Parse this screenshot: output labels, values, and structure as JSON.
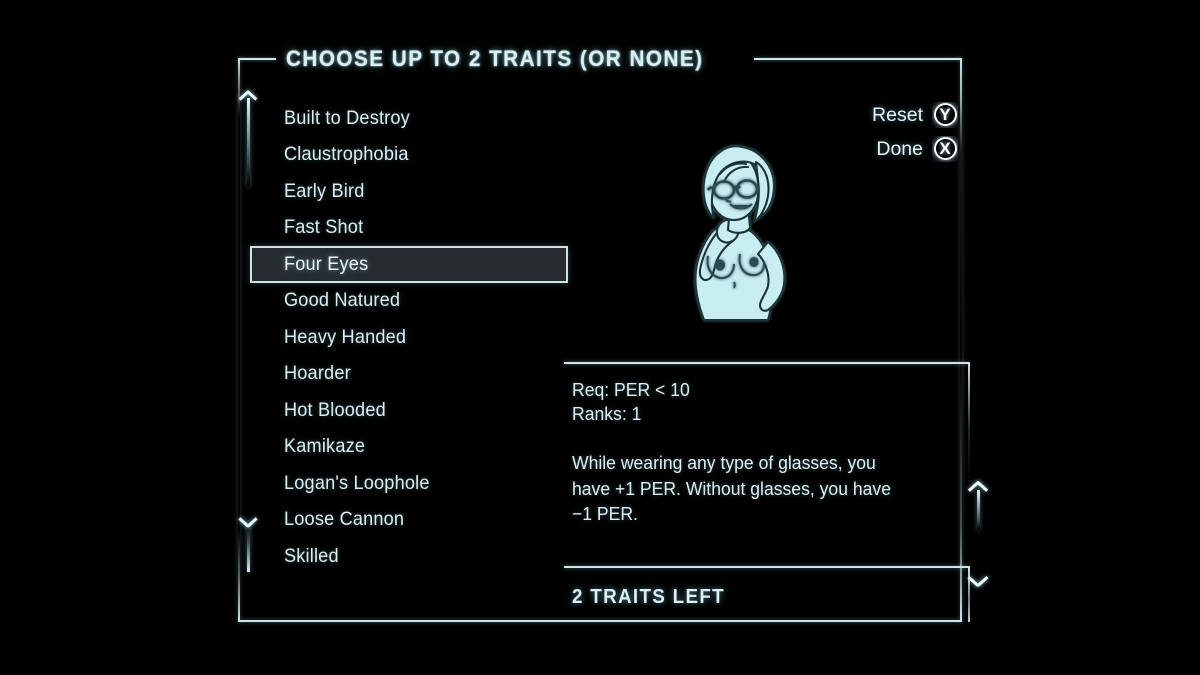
{
  "dialog": {
    "title": "CHOOSE UP TO 2 TRAITS (OR NONE)"
  },
  "traits": {
    "items": [
      {
        "label": "Built to Destroy",
        "selected": false
      },
      {
        "label": "Claustrophobia",
        "selected": false
      },
      {
        "label": "Early Bird",
        "selected": false
      },
      {
        "label": "Fast Shot",
        "selected": false
      },
      {
        "label": "Four Eyes",
        "selected": true
      },
      {
        "label": "Good Natured",
        "selected": false
      },
      {
        "label": "Heavy Handed",
        "selected": false
      },
      {
        "label": "Hoarder",
        "selected": false
      },
      {
        "label": "Hot Blooded",
        "selected": false
      },
      {
        "label": "Kamikaze",
        "selected": false
      },
      {
        "label": "Logan's Loophole",
        "selected": false
      },
      {
        "label": "Loose Cannon",
        "selected": false
      },
      {
        "label": "Skilled",
        "selected": false
      }
    ],
    "scroll_up_icon": "chevron-up-icon",
    "scroll_down_icon": "chevron-down-icon"
  },
  "actions": [
    {
      "label": "Reset",
      "key": "Y"
    },
    {
      "label": "Done",
      "key": "X"
    }
  ],
  "portrait": {
    "icon": "trait-character-portrait"
  },
  "description": {
    "requirement": "Req: PER < 10",
    "ranks": "Ranks: 1",
    "text": "While wearing any type of glasses, you have +1 PER. Without glasses, you have −1 PER.",
    "scroll_up_icon": "chevron-up-icon",
    "scroll_down_icon": "chevron-down-icon"
  },
  "status": {
    "traits_left": "2 TRAITS LEFT"
  },
  "colors": {
    "background": "#000000",
    "accent": "#cfe6ea",
    "text": "#dcf0f3",
    "selected_fill": "#262c2e",
    "portrait": "#cdeef0"
  }
}
